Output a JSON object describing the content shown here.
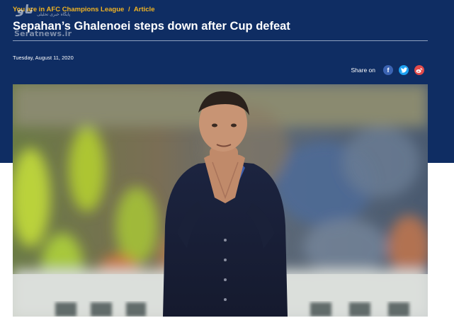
{
  "breadcrumb": {
    "prefix": "You are in",
    "section": "AFC Champions League",
    "separator": "/",
    "current": "Article"
  },
  "watermark": {
    "logo_text": "ﺗﺎﻭ",
    "subtitle": "پایگاه خبری تحلیلی",
    "url": "Seratnews.ir"
  },
  "article": {
    "title": "Sepahan’s Ghalenoei steps down after Cup defeat",
    "date": "Tuesday, August 11, 2020"
  },
  "share": {
    "label": "Share on",
    "icons": [
      "facebook-icon",
      "twitter-icon",
      "weibo-icon"
    ]
  },
  "colors": {
    "header_bg": "#0f2d63",
    "breadcrumb": "#f0b323",
    "facebook": "#3b63b2",
    "twitter": "#1da1f2",
    "weibo": "#e24a4a"
  }
}
